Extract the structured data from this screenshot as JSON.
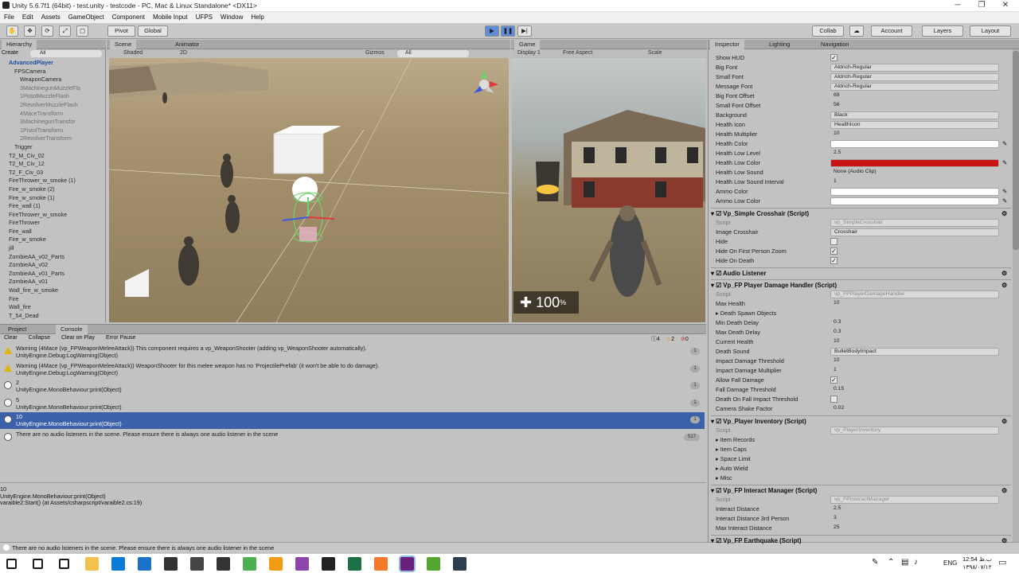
{
  "window": {
    "title": "Unity 5.6.7f1 (64bit) - test.unity - testcode - PC, Mac & Linux Standalone* <DX11>"
  },
  "menu": [
    "File",
    "Edit",
    "Assets",
    "GameObject",
    "Component",
    "Mobile Input",
    "UFPS",
    "Window",
    "Help"
  ],
  "toolbar": {
    "pivot": "Pivot",
    "global": "Global",
    "collab": "Collab",
    "account": "Account",
    "layers": "Layers",
    "layout": "Layout"
  },
  "hierarchy": {
    "tab": "Hierarchy",
    "create": "Create",
    "search": "All",
    "items": [
      {
        "label": "AdvancedPlayer",
        "indent": 1,
        "style": "sel"
      },
      {
        "label": "FPSCamera",
        "indent": 2,
        "style": ""
      },
      {
        "label": "WeaponCamera",
        "indent": 3,
        "style": ""
      },
      {
        "label": "3MachinegunMuzzleFla",
        "indent": 3,
        "style": "dim"
      },
      {
        "label": "1PistolMuzzleFlash",
        "indent": 3,
        "style": "dim"
      },
      {
        "label": "2RevolverMuzzleFlash",
        "indent": 3,
        "style": "dim"
      },
      {
        "label": "4MaceTransform",
        "indent": 3,
        "style": "dim"
      },
      {
        "label": "3MachinegunTransfor",
        "indent": 3,
        "style": "dim"
      },
      {
        "label": "1PistolTransform",
        "indent": 3,
        "style": "dim"
      },
      {
        "label": "2RevolverTransform",
        "indent": 3,
        "style": "dim"
      },
      {
        "label": "Trigger",
        "indent": 2,
        "style": ""
      },
      {
        "label": "T2_M_Civ_02",
        "indent": 1,
        "style": ""
      },
      {
        "label": "T2_M_Civ_12",
        "indent": 1,
        "style": ""
      },
      {
        "label": "T2_F_Civ_03",
        "indent": 1,
        "style": ""
      },
      {
        "label": "FireThrower_w_smoke (1)",
        "indent": 1,
        "style": ""
      },
      {
        "label": "Fire_w_smoke (2)",
        "indent": 1,
        "style": ""
      },
      {
        "label": "Fire_w_smoke (1)",
        "indent": 1,
        "style": ""
      },
      {
        "label": "Fire_wall (1)",
        "indent": 1,
        "style": ""
      },
      {
        "label": "FireThrower_w_smoke",
        "indent": 1,
        "style": ""
      },
      {
        "label": "FireThrower",
        "indent": 1,
        "style": ""
      },
      {
        "label": "Fire_wall",
        "indent": 1,
        "style": ""
      },
      {
        "label": "Fire_w_smoke",
        "indent": 1,
        "style": ""
      },
      {
        "label": "jill",
        "indent": 1,
        "style": ""
      },
      {
        "label": "ZombieAA_v02_Parts",
        "indent": 1,
        "style": ""
      },
      {
        "label": "ZombieAA_v02",
        "indent": 1,
        "style": ""
      },
      {
        "label": "ZombieAA_v01_Parts",
        "indent": 1,
        "style": ""
      },
      {
        "label": "ZombieAA_v01",
        "indent": 1,
        "style": ""
      },
      {
        "label": "Wall_fire_w_smoke",
        "indent": 1,
        "style": ""
      },
      {
        "label": "Fire",
        "indent": 1,
        "style": ""
      },
      {
        "label": "Wall_fire",
        "indent": 1,
        "style": ""
      },
      {
        "label": "T_54_Dead",
        "indent": 1,
        "style": ""
      }
    ]
  },
  "scene": {
    "tab": "Scene",
    "tab2": "Animator",
    "shaded": "Shaded",
    "mode2d": "2D",
    "gizmos": "Gizmos",
    "search": "All"
  },
  "game": {
    "tab": "Game",
    "display": "Display 1",
    "aspect": "Free Aspect",
    "scale": "Scale",
    "health": "100",
    "percent": "%"
  },
  "console": {
    "tab_project": "Project",
    "tab": "Console",
    "buttons": [
      "Clear",
      "Collapse",
      "Clear on Play",
      "Error Pause"
    ],
    "counts": {
      "info": "4",
      "warn": "2",
      "err": "0"
    },
    "rows": [
      {
        "type": "warn",
        "line1": "Warning (4Mace (vp_FPWeaponMeleeAttack)) This component requires a vp_WeaponShooter (adding vp_WeaponShooter automatically).",
        "line2": "UnityEngine.Debug:LogWarning(Object)",
        "count": "1",
        "selected": false
      },
      {
        "type": "warn",
        "line1": "Warning (4Mace (vp_FPWeaponMeleeAttack)) WeaponShooter for this melee weapon has no 'ProjectilePrefab' (it won't be able to do damage).",
        "line2": "UnityEngine.Debug:LogWarning(Object)",
        "count": "1",
        "selected": false
      },
      {
        "type": "info",
        "line1": "2",
        "line2": "UnityEngine.MonoBehaviour:print(Object)",
        "count": "1",
        "selected": false
      },
      {
        "type": "info",
        "line1": "5",
        "line2": "UnityEngine.MonoBehaviour:print(Object)",
        "count": "1",
        "selected": false
      },
      {
        "type": "info",
        "line1": "10",
        "line2": "UnityEngine.MonoBehaviour:print(Object)",
        "count": "1",
        "selected": true
      },
      {
        "type": "info",
        "line1": "There are no audio listeners in the scene. Please ensure there is always one audio listener in the scene",
        "line2": "",
        "count": "517",
        "selected": false
      }
    ],
    "detail": [
      "10",
      "UnityEngine.MonoBehaviour:print(Object)",
      "varaible2:Start() (at Assets/csharpscript/varaible2.cs:19)"
    ]
  },
  "status": {
    "text": "There are no audio listeners in the scene. Please ensure there is always one audio listener in the scene"
  },
  "inspector": {
    "tabs": [
      "Inspector",
      "Lighting",
      "Navigation"
    ],
    "rows": [
      {
        "label": "Show HUD",
        "kind": "check",
        "value": "✓"
      },
      {
        "label": "Big Font",
        "kind": "field",
        "value": "Aldrich-Regular"
      },
      {
        "label": "Small Font",
        "kind": "field",
        "value": "Aldrich-Regular"
      },
      {
        "label": "Message Font",
        "kind": "field",
        "value": "Aldrich-Regular"
      },
      {
        "label": "Big Font Offset",
        "kind": "text",
        "value": "69"
      },
      {
        "label": "Small Font Offset",
        "kind": "text",
        "value": "56"
      },
      {
        "label": "Background",
        "kind": "field",
        "value": "Black"
      },
      {
        "label": "Health Icon",
        "kind": "field",
        "value": "HealthIcon"
      },
      {
        "label": "Health Multiplier",
        "kind": "text",
        "value": "10"
      },
      {
        "label": "Health Color",
        "kind": "color",
        "value": "#ffffff"
      },
      {
        "label": "Health Low Level",
        "kind": "text",
        "value": "2.5"
      },
      {
        "label": "Health Low Color",
        "kind": "color",
        "value": "#c81414"
      },
      {
        "label": "Health Low Sound",
        "kind": "text",
        "value": "None (Audio Clip)"
      },
      {
        "label": "Health Low Sound Interval",
        "kind": "text",
        "value": "1"
      },
      {
        "label": "Ammo Color",
        "kind": "color",
        "value": "#ffffff"
      },
      {
        "label": "Ammo Low Color",
        "kind": "color",
        "value": "#ffffff"
      }
    ],
    "components": [
      {
        "title": "Vp_Simple Crosshair (Script)",
        "rows": [
          {
            "label": "Script",
            "kind": "dim",
            "value": "vp_SimpleCrosshair"
          },
          {
            "label": "Image Crosshair",
            "kind": "field",
            "value": "Crosshair"
          },
          {
            "label": "Hide",
            "kind": "check",
            "value": ""
          },
          {
            "label": "Hide On First Person Zoom",
            "kind": "check",
            "value": "✓"
          },
          {
            "label": "Hide On Death",
            "kind": "check",
            "value": "✓"
          }
        ]
      },
      {
        "title": "Audio Listener",
        "rows": []
      },
      {
        "title": "Vp_FP Player Damage Handler (Script)",
        "rows": [
          {
            "label": "Script",
            "kind": "dim",
            "value": "vp_FPPlayerDamageHandler"
          },
          {
            "label": "Max Health",
            "kind": "text",
            "value": "10"
          },
          {
            "label": "Death Spawn Objects",
            "kind": "head",
            "value": ""
          },
          {
            "label": "Min Death Delay",
            "kind": "text",
            "value": "0.3"
          },
          {
            "label": "Max Death Delay",
            "kind": "text",
            "value": "0.3"
          },
          {
            "label": "Current Health",
            "kind": "text",
            "value": "10"
          },
          {
            "label": "Death Sound",
            "kind": "field",
            "value": "BulletBodyImpact"
          },
          {
            "label": "Impact Damage Threshold",
            "kind": "text",
            "value": "10"
          },
          {
            "label": "Impact Damage Multiplier",
            "kind": "text",
            "value": "1"
          },
          {
            "label": "Allow Fall Damage",
            "kind": "check",
            "value": "✓"
          },
          {
            "label": "Fall Damage Threshold",
            "kind": "text",
            "value": "0.15"
          },
          {
            "label": "Death On Fall Impact Threshold",
            "kind": "check",
            "value": ""
          },
          {
            "label": "Camera Shake Factor",
            "kind": "text",
            "value": "0.02"
          }
        ]
      },
      {
        "title": "Vp_Player Inventory (Script)",
        "rows": [
          {
            "label": "Script",
            "kind": "dim",
            "value": "vp_PlayerInventory"
          },
          {
            "label": "Item Records",
            "kind": "head",
            "value": ""
          },
          {
            "label": "Item Caps",
            "kind": "head",
            "value": ""
          },
          {
            "label": "Space Limit",
            "kind": "head",
            "value": ""
          },
          {
            "label": "Auto Wield",
            "kind": "head",
            "value": ""
          },
          {
            "label": "Misc",
            "kind": "head",
            "value": ""
          }
        ]
      },
      {
        "title": "Vp_FP Interact Manager (Script)",
        "rows": [
          {
            "label": "Script",
            "kind": "dim",
            "value": "vp_FPInteractManager"
          },
          {
            "label": "Interact Distance",
            "kind": "text",
            "value": "2.5"
          },
          {
            "label": "Interact Distance 3rd Person",
            "kind": "text",
            "value": "3"
          },
          {
            "label": "Max Interact Distance",
            "kind": "text",
            "value": "25"
          }
        ]
      },
      {
        "title": "Vp_FP Earthquake (Script)",
        "rows": []
      }
    ]
  },
  "taskbar": {
    "lang": "ENG",
    "time": "12:54 ب.ظ",
    "date": "۱۳۹۸/۰۷/۱۲",
    "icons": [
      {
        "name": "start-icon",
        "color": "#1a1a1a"
      },
      {
        "name": "search-icon",
        "color": "#1a1a1a"
      },
      {
        "name": "task-view-icon",
        "color": "#1a1a1a"
      },
      {
        "name": "file-explorer-icon",
        "color": "#f2c14e"
      },
      {
        "name": "store-icon",
        "color": "#0a7bd6"
      },
      {
        "name": "edge-icon",
        "color": "#1a73c8"
      },
      {
        "name": "camera-icon",
        "color": "#333333"
      },
      {
        "name": "calculator-icon",
        "color": "#444444"
      },
      {
        "name": "mail-icon",
        "color": "#333333"
      },
      {
        "name": "chrome-icon",
        "color": "#4caf50"
      },
      {
        "name": "browser-icon",
        "color": "#f39c12"
      },
      {
        "name": "winrar-icon",
        "color": "#8e44ad"
      },
      {
        "name": "unity-icon",
        "color": "#222222"
      },
      {
        "name": "excel-icon",
        "color": "#1e7145"
      },
      {
        "name": "blender-icon",
        "color": "#f5792a"
      },
      {
        "name": "visual-studio-icon",
        "color": "#68217a"
      },
      {
        "name": "notepad-plus-icon",
        "color": "#55a630"
      },
      {
        "name": "terminal-icon",
        "color": "#2c3e50"
      }
    ]
  }
}
